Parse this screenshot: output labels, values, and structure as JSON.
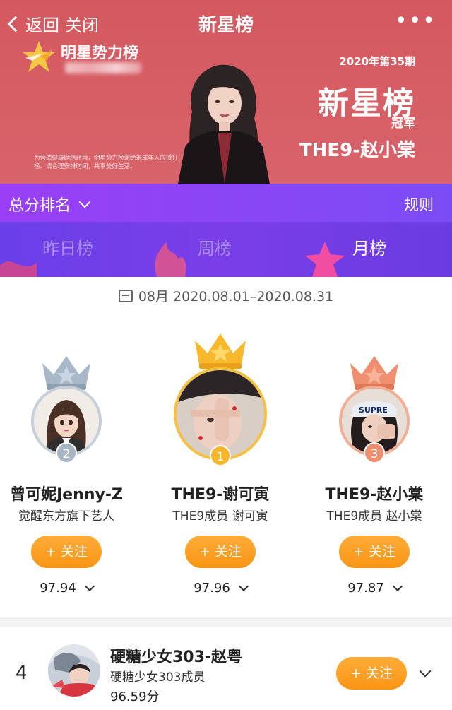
{
  "nav": {
    "back_label": "返回",
    "close_label": "关闭",
    "title": "新星榜",
    "more_label": "•••"
  },
  "banner": {
    "logo_text": "明星势力榜",
    "period": "2020年第35期",
    "title": "新星榜",
    "champion_label": "冠军",
    "winner": "THE9-赵小棠",
    "notice": "为营造健康网络环境，明星势力榜谢绝未成年人应援打榜。请合理安排时间，共享美好生活。"
  },
  "rankbar": {
    "selector_label": "总分排名",
    "rules_label": "规则"
  },
  "tabs": [
    {
      "label": "昨日榜",
      "active": false
    },
    {
      "label": "周榜",
      "active": false
    },
    {
      "label": "月榜",
      "active": true
    }
  ],
  "date_range": "08月 2020.08.01–2020.08.31",
  "podium": [
    {
      "rank": "2",
      "name": "曾可妮Jenny-Z",
      "subtitle": "觉醒东方旗下艺人",
      "follow_label": "+ 关注",
      "score": "97.94",
      "crown_color": "#a9b8c8"
    },
    {
      "rank": "1",
      "name": "THE9-谢可寅",
      "subtitle": "THE9成员 谢可寅",
      "follow_label": "+ 关注",
      "score": "97.96",
      "crown_color": "#f7b82c"
    },
    {
      "rank": "3",
      "name": "THE9-赵小棠",
      "subtitle": "THE9成员 赵小棠",
      "follow_label": "+ 关注",
      "score": "97.87",
      "crown_color": "#ef8f6f"
    }
  ],
  "list": [
    {
      "rank": "4",
      "name": "硬糖少女303-赵粤",
      "subtitle": "硬糖少女303成员",
      "score": "96.59分",
      "follow_label": "+ 关注"
    }
  ],
  "colors": {
    "banner_bg": "#d55a61",
    "rankbar_bg": "#8b45f5",
    "follow_btn": "#f99514"
  }
}
